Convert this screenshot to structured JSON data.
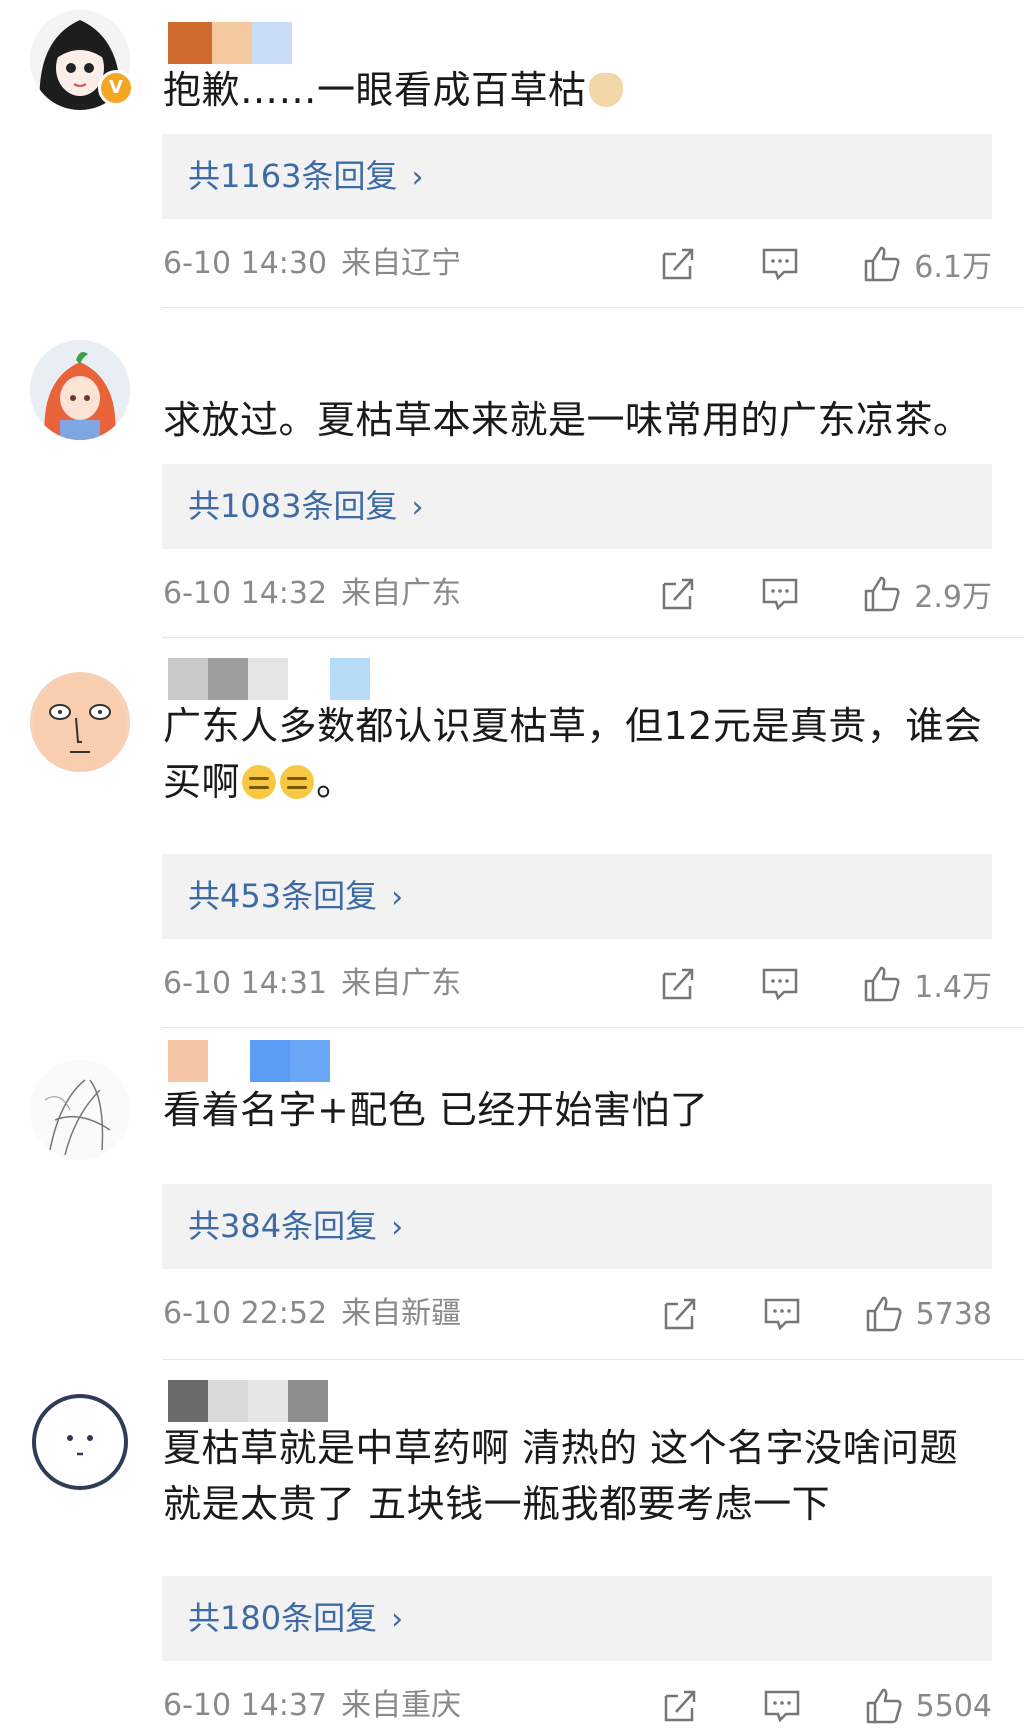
{
  "comments": [
    {
      "text": "抱歉……一眼看成百草枯",
      "replies": "共1163条回复",
      "time": "6-10 14:30",
      "location": "来自辽宁",
      "likes": "6.1万",
      "verified": true,
      "emoji": "cat-icon"
    },
    {
      "text": "求放过。夏枯草本来就是一味常用的广东凉茶。",
      "replies": "共1083条回复",
      "time": "6-10 14:32",
      "location": "来自广东",
      "likes": "2.9万"
    },
    {
      "text_line1": "广东人多数都认识夏枯草，但12元是真贵，谁会",
      "text_line2": "买啊",
      "text_tail": "。",
      "replies": "共453条回复",
      "time": "6-10 14:31",
      "location": "来自广东",
      "likes": "1.4万",
      "emoji": "speechless-face-icon"
    },
    {
      "text": "看着名字+配色 已经开始害怕了",
      "replies": "共384条回复",
      "time": "6-10 22:52",
      "location": "来自新疆",
      "likes": "5738"
    },
    {
      "text_line1": "夏枯草就是中草药啊 清热的 这个名字没啥问题",
      "text_line2": "就是太贵了 五块钱一瓶我都要考虑一下",
      "replies": "共180条回复",
      "time": "6-10 14:37",
      "location": "来自重庆",
      "likes": "5504"
    }
  ],
  "ui": {
    "arrow": "›",
    "verified_badge": "V"
  },
  "colors": {
    "reply_link": "#3d6aa5",
    "reply_bg": "#f2f2f2",
    "meta": "#8a8a8a",
    "verified": "#f5a623"
  }
}
